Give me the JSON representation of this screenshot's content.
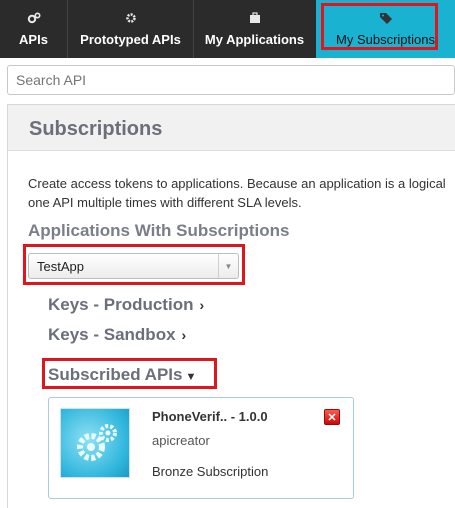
{
  "nav": {
    "tabs": [
      {
        "label": "APIs",
        "icon": "cogs-icon"
      },
      {
        "label": "Prototyped APIs",
        "icon": "cog-icon"
      },
      {
        "label": "My Applications",
        "icon": "briefcase-icon"
      },
      {
        "label": "My Subscriptions",
        "icon": "tags-icon",
        "active": true
      }
    ],
    "active_color": "#1ab2d1",
    "highlight_color": "#e0151d"
  },
  "search": {
    "placeholder": "Search API"
  },
  "panel": {
    "title": "Subscriptions",
    "description_line1": "Create access tokens to applications. Because an application is a logical",
    "description_line2": "one API multiple times with different SLA levels.",
    "apps_heading": "Applications With Subscriptions",
    "app_select": {
      "selected": "TestApp"
    },
    "keys_production": "Keys - Production",
    "keys_sandbox": "Keys - Sandbox",
    "subscribed_apis": "Subscribed APIs"
  },
  "api_card": {
    "name": "PhoneVerif.. - 1.0.0",
    "provider": "apicreator",
    "tier": "Bronze Subscription",
    "delete_label": "✕"
  }
}
